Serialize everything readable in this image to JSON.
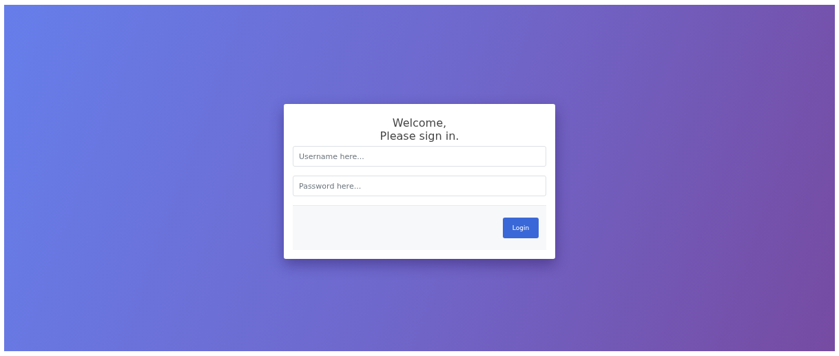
{
  "login_card": {
    "title_lines": [
      "Welcome,",
      "Please sign in."
    ],
    "fields": [
      {
        "placeholder": "Username here..."
      },
      {
        "placeholder": "Password here..."
      }
    ],
    "button": "Login"
  }
}
